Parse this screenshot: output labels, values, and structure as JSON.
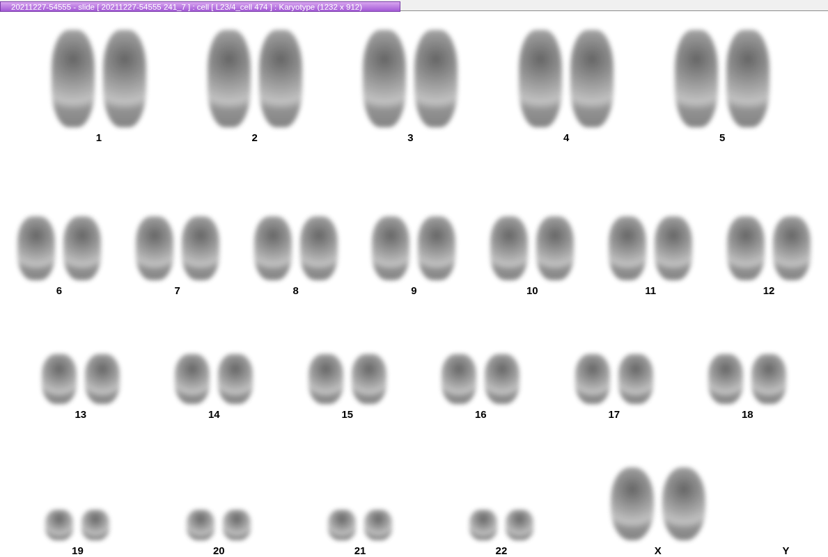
{
  "window": {
    "title": "20211227-54555 - slide [ 20211227-54555 241_7 ] : cell [ L23/4_cell 474 ] : Karyotype  (1232 x 912)"
  },
  "rows": [
    {
      "pairs": [
        {
          "label": "1",
          "kind": "autosome"
        },
        {
          "label": "2",
          "kind": "autosome"
        },
        {
          "label": "3",
          "kind": "autosome"
        },
        {
          "label": "4",
          "kind": "autosome"
        },
        {
          "label": "5",
          "kind": "autosome"
        }
      ]
    },
    {
      "pairs": [
        {
          "label": "6",
          "kind": "autosome"
        },
        {
          "label": "7",
          "kind": "autosome"
        },
        {
          "label": "8",
          "kind": "autosome"
        },
        {
          "label": "9",
          "kind": "autosome"
        },
        {
          "label": "10",
          "kind": "autosome"
        },
        {
          "label": "11",
          "kind": "autosome"
        },
        {
          "label": "12",
          "kind": "autosome"
        }
      ]
    },
    {
      "pairs": [
        {
          "label": "13",
          "kind": "autosome"
        },
        {
          "label": "14",
          "kind": "autosome"
        },
        {
          "label": "15",
          "kind": "autosome"
        },
        {
          "label": "16",
          "kind": "autosome"
        },
        {
          "label": "17",
          "kind": "autosome"
        },
        {
          "label": "18",
          "kind": "autosome"
        }
      ]
    },
    {
      "pairs": [
        {
          "label": "19",
          "kind": "autosome"
        },
        {
          "label": "20",
          "kind": "autosome"
        },
        {
          "label": "21",
          "kind": "autosome"
        },
        {
          "label": "22",
          "kind": "autosome"
        },
        {
          "label": "X",
          "kind": "sex"
        },
        {
          "label": "Y",
          "kind": "empty"
        }
      ]
    }
  ]
}
